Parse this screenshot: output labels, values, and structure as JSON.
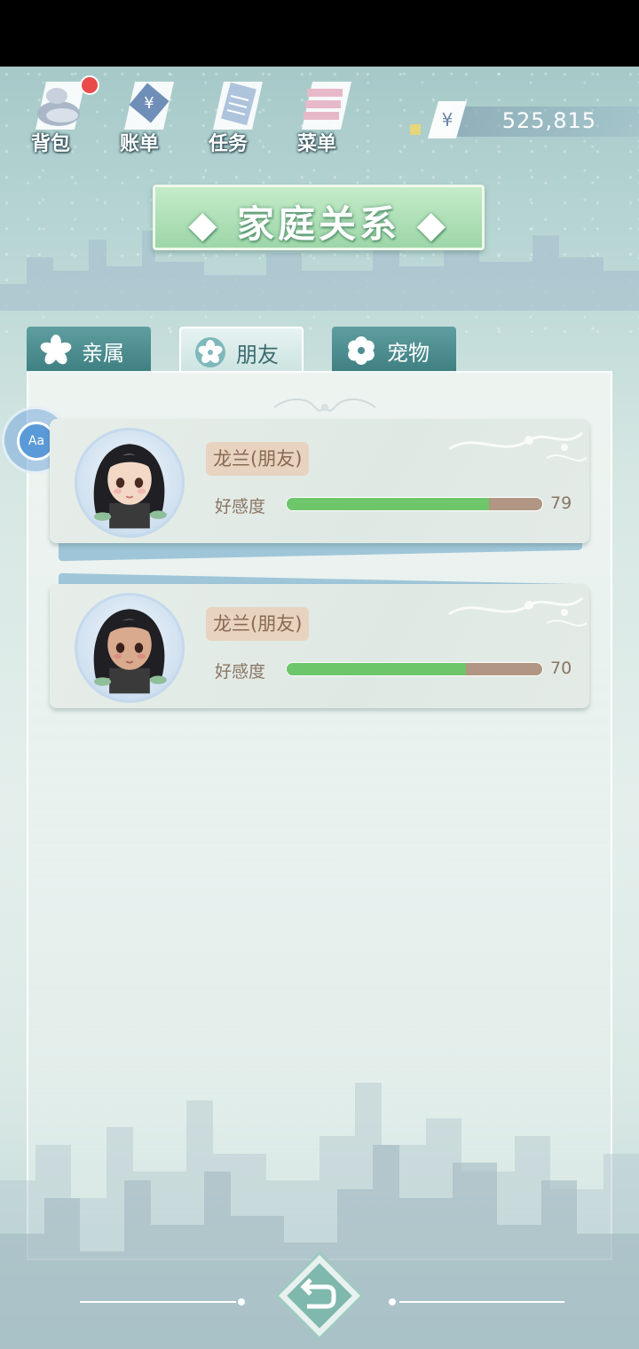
{
  "nav": {
    "items": [
      {
        "label": "背包",
        "icon": "backpack-icon"
      },
      {
        "label": "账单",
        "icon": "bill-icon"
      },
      {
        "label": "任务",
        "icon": "task-icon"
      },
      {
        "label": "菜单",
        "icon": "menu-icon"
      }
    ],
    "money": {
      "symbol": "¥",
      "value": "525,815"
    }
  },
  "title": "家庭关系",
  "tabs": [
    {
      "label": "亲属",
      "icon": "sakura-icon",
      "active": false
    },
    {
      "label": "朋友",
      "icon": "flower-icon",
      "active": true
    },
    {
      "label": "宠物",
      "icon": "flower-icon",
      "active": false
    }
  ],
  "search_button": {
    "label": "Aa"
  },
  "friends": [
    {
      "name": "龙兰(朋友)",
      "favor_label": "好感度",
      "favor": 79,
      "favor_max": 100
    },
    {
      "name": "龙兰(朋友)",
      "favor_label": "好感度",
      "favor": 70,
      "favor_max": 100
    }
  ],
  "colors": {
    "favor_fill": "#6ec66a",
    "favor_track": "#b09683",
    "tab_active": "#e6f3f1",
    "tab_inactive": "#4d8f92",
    "title_banner": "#b2e0b8"
  }
}
